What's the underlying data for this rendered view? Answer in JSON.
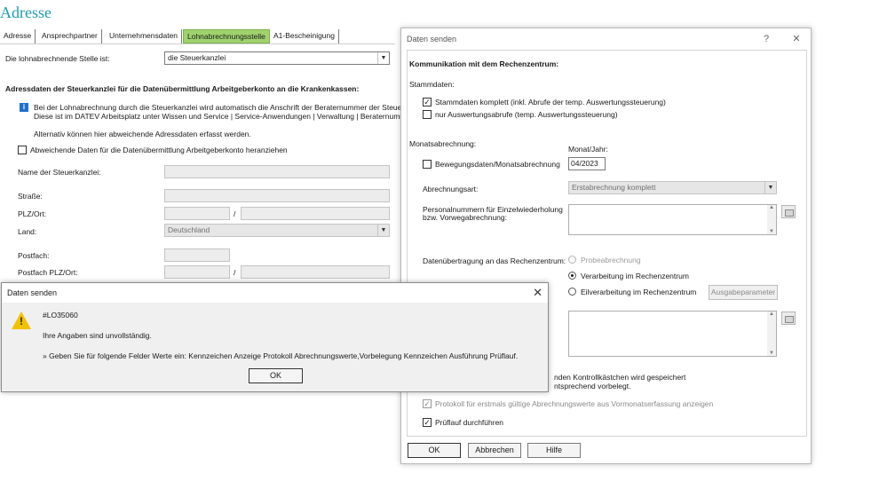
{
  "page": {
    "title": "Adresse",
    "tabs": [
      "Adresse",
      "Ansprechpartner",
      "Unternehmensdaten",
      "Lohnabrechnungsstelle",
      "A1-Bescheinigung"
    ],
    "active_tab": "Lohnabrechnungsstelle",
    "stelle_label": "Die lohnabrechnende Stelle ist:",
    "stelle_value": "die Steuerkanzlei",
    "section_heading": "Adressdaten der Steuerkanzlei für die Datenübermittlung Arbeitgeberkonto an die Krankenkassen:",
    "info_line1": "Bei der Lohnabrechnung durch die Steuerkanzlei wird automatisch die Anschrift der Beraternummer der Steuerkanzl",
    "info_line2": "Diese ist im DATEV Arbeitsplatz unter Wissen und Service | Service-Anwendungen | Verwaltung | Beraternummer ve",
    "info_line3": "Alternativ können hier abweichende Adressdaten erfasst werden.",
    "abweichend_label": "Abweichende Daten für die Datenübermittlung Arbeitgeberkonto heranziehen",
    "name_label": "Name der Steuerkanzlei:",
    "strasse_label": "Straße:",
    "plz_label": "PLZ/Ort:",
    "land_label": "Land:",
    "land_value": "Deutschland",
    "postfach_label": "Postfach:",
    "postfach_plz_label": "Postfach PLZ/Ort:",
    "slash": "/"
  },
  "dialog_send": {
    "title": "Daten senden",
    "help_icon": "?",
    "close_icon": "✕",
    "heading": "Kommunikation mit dem Rechenzentrum:",
    "stammdaten_label": "Stammdaten:",
    "cb_stammdaten": "Stammdaten komplett (inkl. Abrufe der temp. Auswertungssteuerung)",
    "cb_stammdaten_checked": true,
    "cb_auswertung": "nur Auswertungsabrufe (temp. Auswertungssteuerung)",
    "cb_auswertung_checked": false,
    "monats_label": "Monatsabrechnung:",
    "monat_jahr_label": "Monat/Jahr:",
    "cb_bewegung": "Bewegungsdaten/Monatsabrechnung",
    "monat_jahr_value": "04/2023",
    "abrechnungsart_label": "Abrechnungsart:",
    "abrechnungsart_value": "Erstabrechnung komplett",
    "personalnr_label1": "Personalnummern für Einzelwiederholung",
    "personalnr_label2": "bzw. Vorwegabrechnung:",
    "uebertragung_label": "Datenübertragung an das Rechenzentrum:",
    "rb_probe": "Probeabrechnung",
    "rb_verarbeitung": "Verarbeitung im Rechenzentrum",
    "rb_eil": "Eilverarbeitung im Rechenzentrum",
    "ausgabe_button": "Ausgabeparameter",
    "hint_line1": "nden Kontrollkästchen wird gespeichert",
    "hint_line2": "ntsprechend vorbelegt.",
    "cb_protokoll": "Protokoll für erstmals gültige Abrechnungswerte aus Vormonatserfassung anzeigen",
    "cb_protokoll_checked": true,
    "cb_pruef": "Prüflauf durchführen",
    "cb_pruef_checked": true,
    "ok_button": "OK",
    "abbrechen_button": "Abbrechen",
    "hilfe_button": "Hilfe",
    "check_mark": "✓"
  },
  "dialog_error": {
    "title": "Daten senden",
    "close_icon": "✕",
    "code": "#LO35060",
    "message": "Ihre Angaben sind unvollständig.",
    "detail": "» Geben Sie für folgende Felder Werte ein: Kennzeichen Anzeige Protokoll Abrechnungswerte,Vorbelegung Kennzeichen Ausführung Prüflauf.",
    "ok_button": "OK",
    "warn_mark": "!"
  },
  "icons": {
    "info": "i",
    "arrow_down": "▼",
    "scroll_up": "▲",
    "scroll_down": "▼"
  },
  "colors": {
    "title": "#1f9dab",
    "active_tab": "#9fd26e",
    "warning": "#f2c200",
    "info": "#1f6fd1"
  }
}
